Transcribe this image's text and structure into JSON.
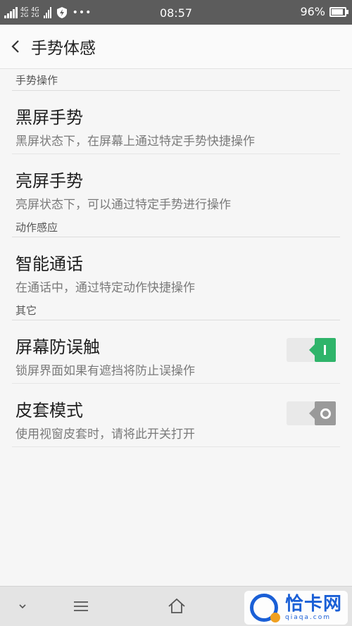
{
  "status_bar": {
    "sim1": "2G",
    "net1": "4G",
    "net2": "4G",
    "sim2": "2G",
    "time": "08:57",
    "battery": "96%",
    "battery_level": 0.96,
    "dots": "•••"
  },
  "header": {
    "title": "手势体感"
  },
  "sections": [
    {
      "header": "手势操作",
      "items": [
        {
          "title": "黑屏手势",
          "subtitle": "黑屏状态下，在屏幕上通过特定手势快捷操作"
        },
        {
          "title": "亮屏手势",
          "subtitle": "亮屏状态下，可以通过特定手势进行操作"
        }
      ]
    },
    {
      "header": "动作感应",
      "items": [
        {
          "title": "智能通话",
          "subtitle": "在通话中，通过特定动作快捷操作"
        }
      ]
    },
    {
      "header": "其它",
      "items": [
        {
          "title": "屏幕防误触",
          "subtitle": "锁屏界面如果有遮挡将防止误操作",
          "toggle": true
        },
        {
          "title": "皮套模式",
          "subtitle": "使用视窗皮套时，请将此开关打开",
          "toggle": false
        }
      ]
    }
  ],
  "watermark": {
    "name": "恰卡网",
    "url": "qiaqa.com"
  },
  "colors": {
    "toggle_on": "#2fb46a",
    "toggle_off": "#9a9a9a",
    "status_bar": "#5c5c5c"
  },
  "icons": {
    "back": "chevron-left-icon",
    "nav": [
      "chevron-down-icon",
      "menu-icon",
      "home-icon"
    ]
  }
}
